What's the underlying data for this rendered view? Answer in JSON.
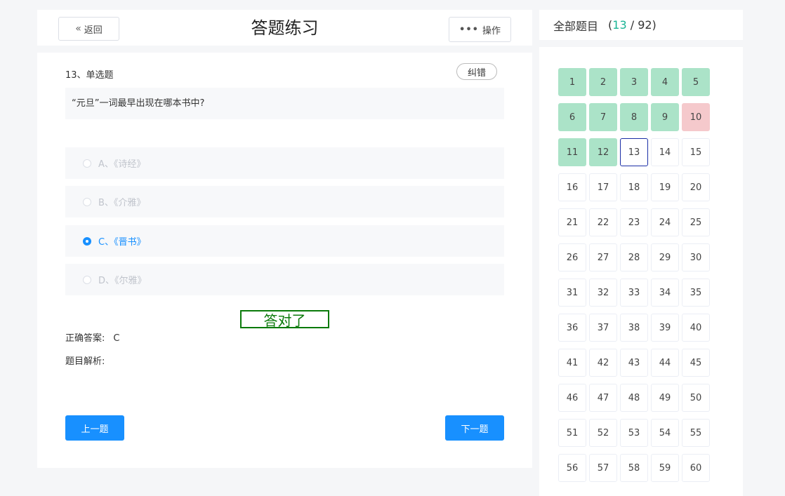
{
  "header": {
    "back_label": "返回",
    "title": "答题练习",
    "ops_label": "操作"
  },
  "question": {
    "type_label": "13、单选题",
    "correct_btn": "纠错",
    "stem": "“元旦”一词最早出现在哪本书中?",
    "options": [
      {
        "label": "A、《诗经》",
        "selected": false
      },
      {
        "label": "B、《介雅》",
        "selected": false
      },
      {
        "label": "C、《晋书》",
        "selected": true
      },
      {
        "label": "D、《尔雅》",
        "selected": false
      }
    ],
    "result": "答对了",
    "answer_label": "正确答案:",
    "answer_value": "C",
    "analysis_label": "题目解析:"
  },
  "nav": {
    "prev": "上一题",
    "next": "下一题"
  },
  "panel": {
    "title": "全部题目",
    "current": "13",
    "total": "92",
    "correct": [
      1,
      2,
      3,
      4,
      5,
      6,
      7,
      8,
      9,
      11,
      12
    ],
    "wrong": [
      10
    ],
    "current_index": 13,
    "visible_count": 60
  },
  "colors": {
    "accent": "#1890ff",
    "correct_cell": "#abe3c8",
    "wrong_cell": "#f5c9cc",
    "result_green": "#0a7a0a",
    "count_teal": "#19b394"
  }
}
